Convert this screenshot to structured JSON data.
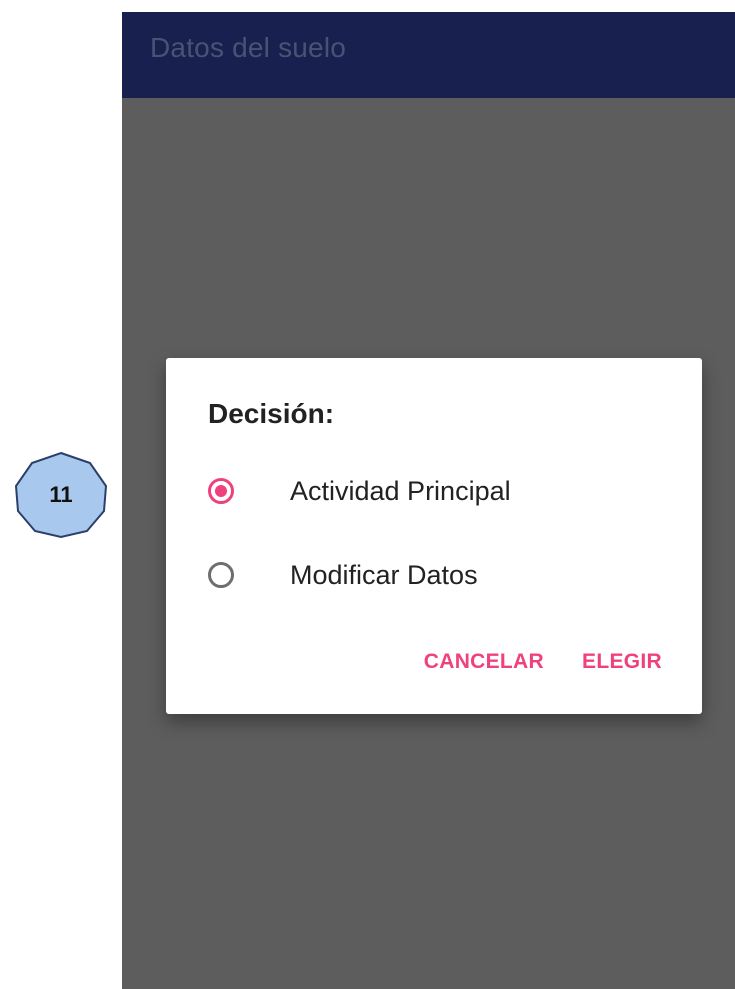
{
  "step_marker": {
    "number": "11",
    "fill_color": "#a9c8ee",
    "stroke_color": "#2b3f6b"
  },
  "app_bar": {
    "title": "Datos del suelo",
    "background_color": "#18204f"
  },
  "dialog": {
    "title": "Decisión:",
    "options": [
      {
        "label": "Actividad Principal",
        "selected": true
      },
      {
        "label": "Modificar Datos",
        "selected": false
      }
    ],
    "actions": {
      "cancel_label": "CANCELAR",
      "choose_label": "ELEGIR"
    },
    "accent_color": "#f0417f"
  },
  "scrim_color": "#5d5d5d"
}
